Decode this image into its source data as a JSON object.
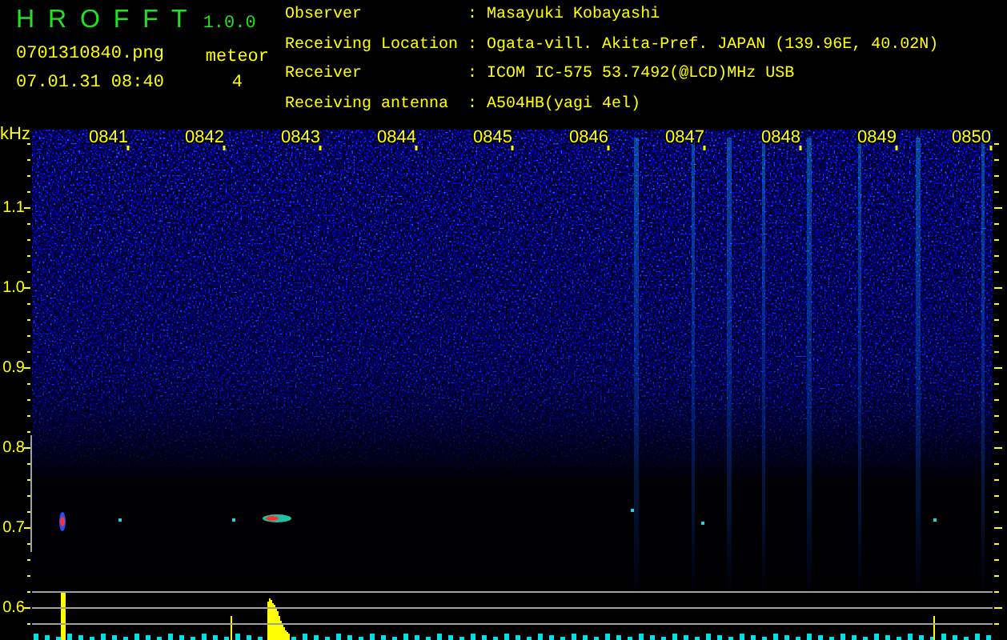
{
  "app": {
    "name": "H R O F F T",
    "version": "1.0.0"
  },
  "file": {
    "name": "0701310840.png",
    "datetime": "07.01.31 08:40"
  },
  "meteor": {
    "label": "meteor",
    "count": "4"
  },
  "info": [
    {
      "label": "Observer",
      "colon": ":",
      "value": "Masayuki Kobayashi"
    },
    {
      "label": "Receiving Location",
      "colon": ":",
      "value": "Ogata-vill. Akita-Pref. JAPAN (139.96E, 40.02N)"
    },
    {
      "label": "Receiver",
      "colon": ":",
      "value": "ICOM IC-575 53.7492(@LCD)MHz USB"
    },
    {
      "label": "Receiving antenna",
      "colon": ":",
      "value": "A504HB(yagi 4el)"
    }
  ],
  "spectrogram": {
    "unit": "kHz",
    "frequency_labels": [
      "1.1",
      "1.0",
      "0.9",
      "0.8",
      "0.7",
      "0.6"
    ],
    "time_labels": [
      "0841",
      "0842",
      "0843",
      "0844",
      "0845",
      "0846",
      "0847",
      "0848",
      "0849",
      "0850"
    ]
  }
}
